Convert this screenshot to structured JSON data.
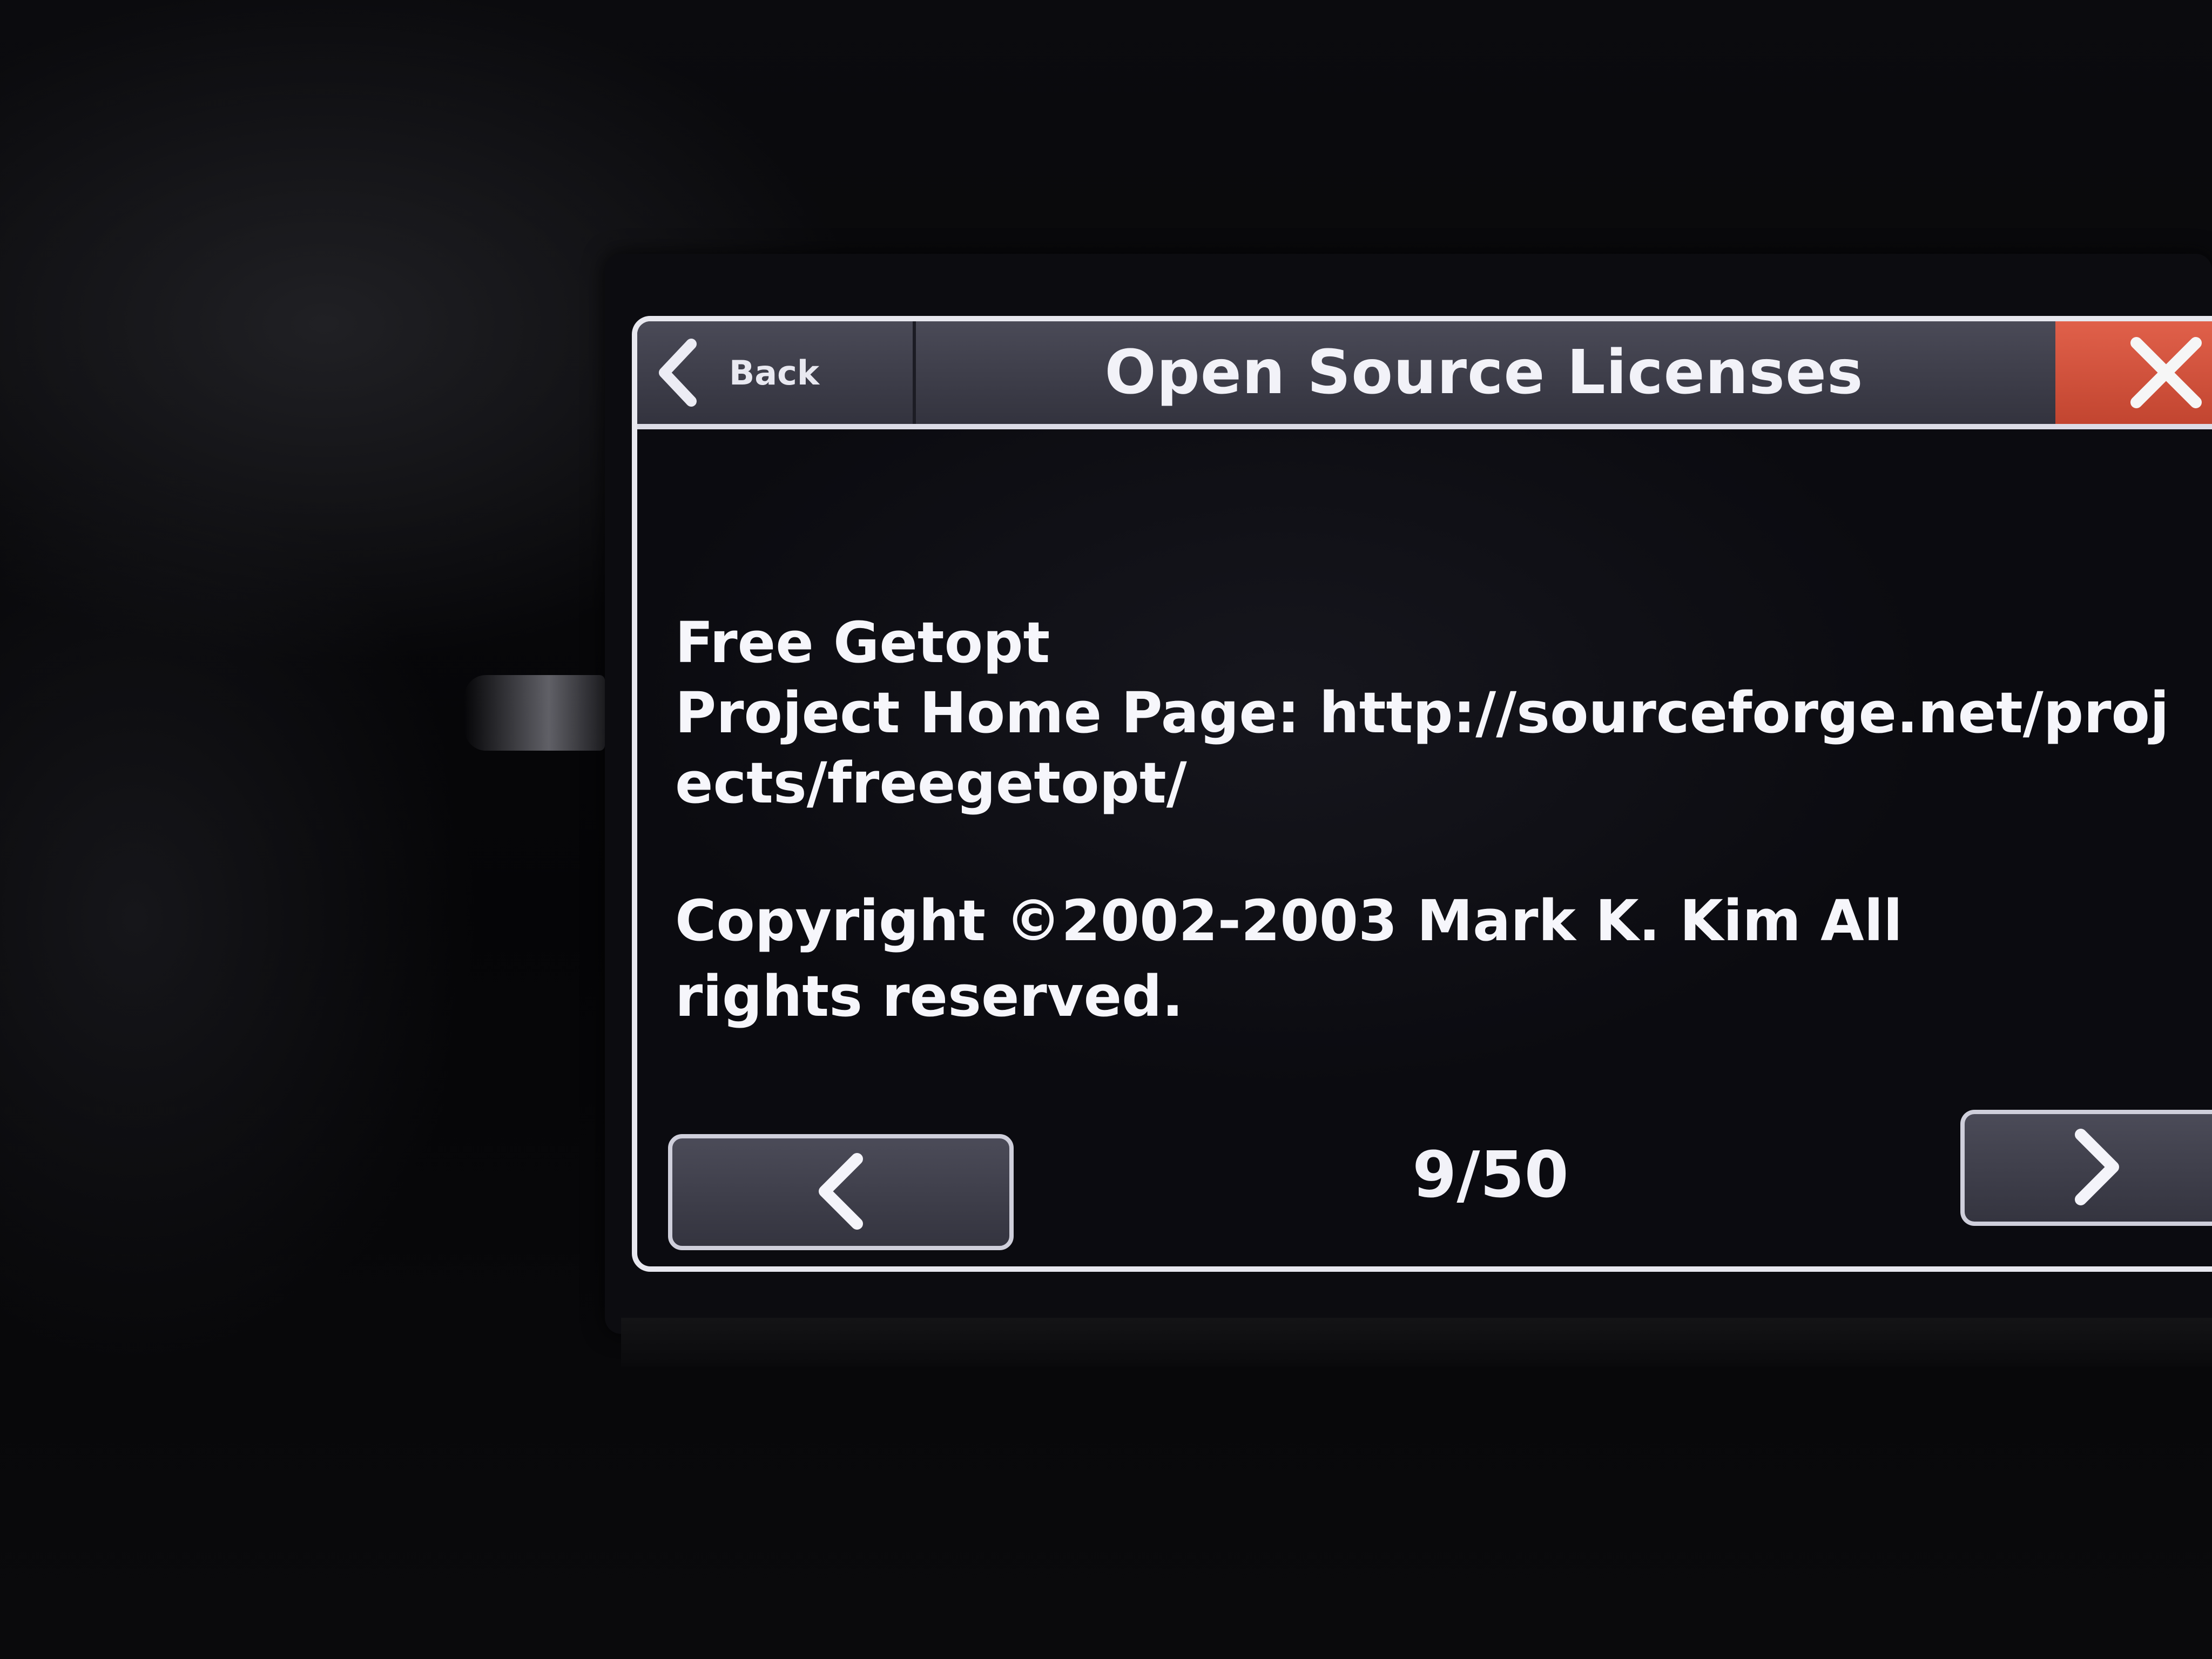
{
  "header": {
    "back_label": "Back",
    "title": "Open Source Licenses"
  },
  "icons": {
    "back": "chevron-left-icon",
    "close": "close-icon",
    "prev": "chevron-left-icon",
    "next": "chevron-right-icon"
  },
  "license": {
    "name": "Free Getopt",
    "home_page": "Project Home Page: http://sourceforge.net/projects/freegetopt/",
    "copyright": "Copyright ©2002-2003 Mark K. Kim All rights reserved."
  },
  "pagination": {
    "indicator": "9/50"
  },
  "colors": {
    "close_button": "#d0513b",
    "header": "#3e3e4a",
    "screen_background": "#0f0f14",
    "text": "#f4f4fa"
  }
}
